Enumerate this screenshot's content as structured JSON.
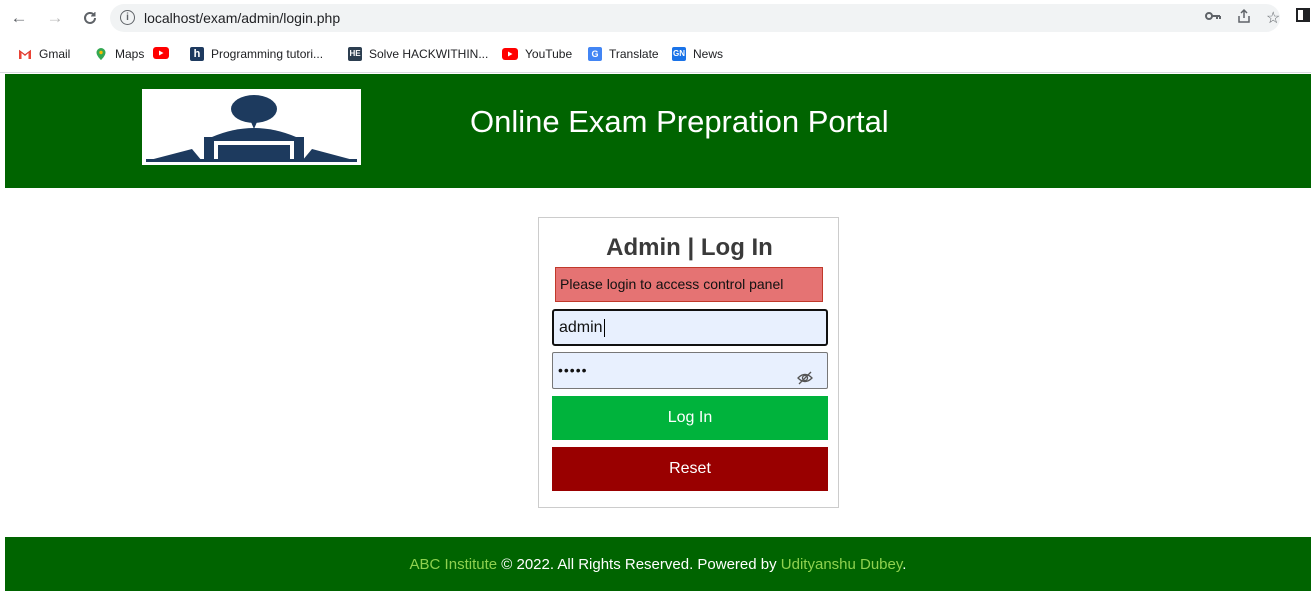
{
  "browser": {
    "url": "localhost/exam/admin/login.php",
    "bookmarks": [
      {
        "label": "Gmail",
        "icon": "gmail-icon",
        "color": "#ea4335"
      },
      {
        "label": "Maps",
        "icon": "maps-icon",
        "color": "#34a853"
      },
      {
        "label": "",
        "icon": "youtube-icon",
        "color": "#ff0000"
      },
      {
        "label": "Programming tutori...",
        "icon": "hackerrank-icon",
        "color": "#1e3a5f"
      },
      {
        "label": "Solve HACKWITHIN...",
        "icon": "hackerearth-icon",
        "color": "#2c3e50"
      },
      {
        "label": "YouTube",
        "icon": "youtube-icon",
        "color": "#ff0000"
      },
      {
        "label": "Translate",
        "icon": "translate-icon",
        "color": "#4285f4"
      },
      {
        "label": "News",
        "icon": "news-icon",
        "color": "#1a73e8"
      }
    ]
  },
  "header": {
    "title": "Online Exam Prepration Portal",
    "bg_color": "#006400"
  },
  "login": {
    "title": "Admin | Log In",
    "alert": "Please login to access control panel",
    "username_value": "admin",
    "password_mask": "•••••",
    "login_label": "Log In",
    "reset_label": "Reset",
    "login_color": "#00b33c",
    "reset_color": "#990000"
  },
  "footer": {
    "org": "ABC Institute",
    "text": " © 2022. All Rights Reserved. Powered by ",
    "author": "Udityanshu Dubey",
    "end": "."
  }
}
